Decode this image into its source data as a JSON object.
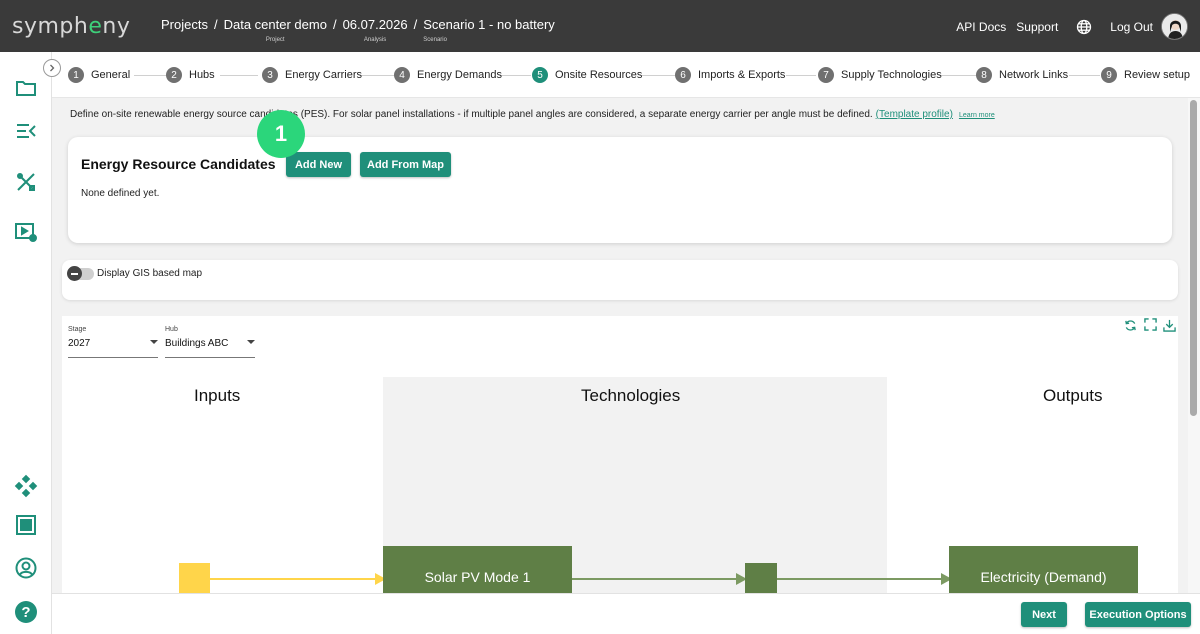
{
  "app": {
    "logo_prefix": "symph",
    "logo_accent": "e",
    "logo_suffix": "ny"
  },
  "breadcrumbs": [
    {
      "label": "Projects",
      "sub": ""
    },
    {
      "label": "Data center demo",
      "sub": "Project"
    },
    {
      "label": "06.07.2026",
      "sub": "Analysis"
    },
    {
      "label": "Scenario 1 - no battery",
      "sub": "Scenario"
    }
  ],
  "header": {
    "api_docs": "API Docs",
    "support": "Support",
    "logout": "Log Out"
  },
  "sidebar": {
    "items": [
      {
        "icon": "folder-icon"
      },
      {
        "icon": "list-collapse-icon"
      },
      {
        "icon": "tools-icon"
      },
      {
        "icon": "video-settings-icon"
      },
      {
        "icon": "network-icon"
      },
      {
        "icon": "grid-icon"
      },
      {
        "icon": "user-circle-icon"
      },
      {
        "icon": "help-icon"
      }
    ]
  },
  "stepper": {
    "steps": [
      {
        "num": "1",
        "label": "General"
      },
      {
        "num": "2",
        "label": "Hubs"
      },
      {
        "num": "3",
        "label": "Energy Carriers"
      },
      {
        "num": "4",
        "label": "Energy Demands"
      },
      {
        "num": "5",
        "label": "Onsite Resources"
      },
      {
        "num": "6",
        "label": "Imports & Exports"
      },
      {
        "num": "7",
        "label": "Supply Technologies"
      },
      {
        "num": "8",
        "label": "Network Links"
      },
      {
        "num": "9",
        "label": "Review setup"
      }
    ],
    "active_step": "5"
  },
  "intro": {
    "text": "Define on-site renewable energy source candidates (PES). For solar panel installations - if multiple panel angles are considered, a separate energy carrier per angle must be defined.",
    "template_link": "(Template profile)",
    "learn_more": "Learn more"
  },
  "candidates": {
    "title": "Energy Resource Candidates",
    "add_new": "Add New",
    "add_from_map": "Add From Map",
    "empty_text": "None defined yet."
  },
  "gis": {
    "label": "Display GIS based map"
  },
  "filters": {
    "stage": {
      "label": "Stage",
      "value": "2027"
    },
    "hub": {
      "label": "Hub",
      "value": "Buildings ABC"
    }
  },
  "diagram": {
    "inputs_title": "Inputs",
    "technologies_title": "Technologies",
    "outputs_title": "Outputs",
    "tech_node": "Solar PV Mode 1",
    "output_node": "Electricity (Demand)",
    "colors": {
      "input": "#ffd54a",
      "node": "#5f7f46",
      "arrow_in": "#ffd54a",
      "arrow_out": "#7c9a62"
    }
  },
  "footer": {
    "next": "Next",
    "execution_options": "Execution Options"
  },
  "tutorial_badge": "1",
  "colors": {
    "accent": "#1f8f7a",
    "topbar": "#3a3a3a",
    "badge": "#2bd67b"
  }
}
